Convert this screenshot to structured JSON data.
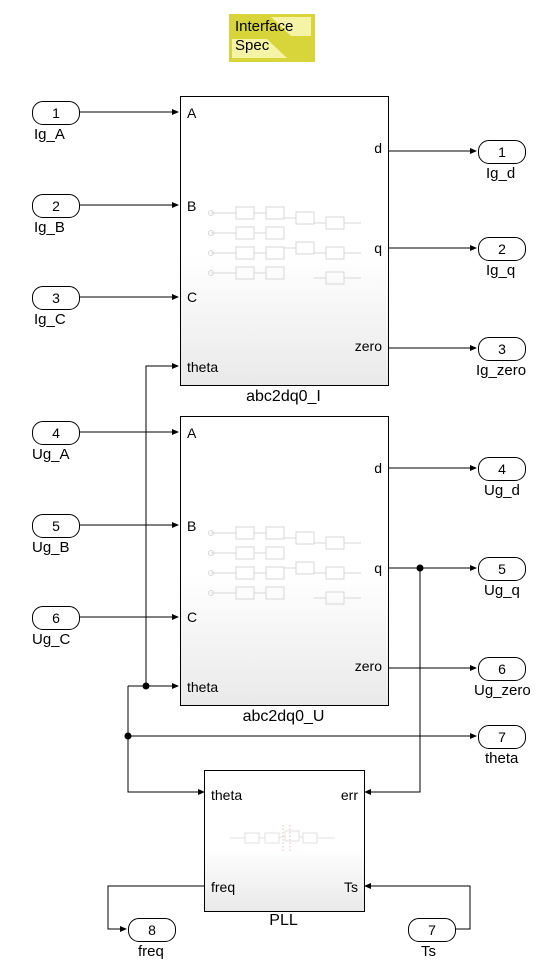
{
  "interface": {
    "line1": "Interface",
    "line2": "Spec"
  },
  "inports": [
    {
      "num": "1",
      "label": "Ig_A"
    },
    {
      "num": "2",
      "label": "Ig_B"
    },
    {
      "num": "3",
      "label": "Ig_C"
    },
    {
      "num": "4",
      "label": "Ug_A"
    },
    {
      "num": "5",
      "label": "Ug_B"
    },
    {
      "num": "6",
      "label": "Ug_C"
    },
    {
      "num": "7",
      "label": "Ts"
    }
  ],
  "outports": [
    {
      "num": "1",
      "label": "Ig_d"
    },
    {
      "num": "2",
      "label": "Ig_q"
    },
    {
      "num": "3",
      "label": "Ig_zero"
    },
    {
      "num": "4",
      "label": "Ug_d"
    },
    {
      "num": "5",
      "label": "Ug_q"
    },
    {
      "num": "6",
      "label": "Ug_zero"
    },
    {
      "num": "7",
      "label": "theta"
    },
    {
      "num": "8",
      "label": "freq"
    }
  ],
  "blocks": {
    "abcI": {
      "title": "abc2dq0_I",
      "ports": {
        "A": "A",
        "B": "B",
        "C": "C",
        "theta": "theta",
        "d": "d",
        "q": "q",
        "zero": "zero"
      }
    },
    "abcU": {
      "title": "abc2dq0_U",
      "ports": {
        "A": "A",
        "B": "B",
        "C": "C",
        "theta": "theta",
        "d": "d",
        "q": "q",
        "zero": "zero"
      }
    },
    "pll": {
      "title": "PLL",
      "ports": {
        "theta": "theta",
        "freq": "freq",
        "err": "err",
        "Ts": "Ts"
      }
    }
  }
}
